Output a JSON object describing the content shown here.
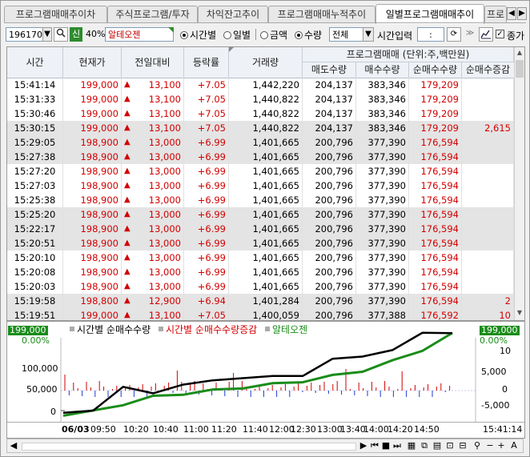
{
  "tabs": [
    {
      "label": "프로그램매매추이차",
      "active": false
    },
    {
      "label": "주식프로그램/투자",
      "active": false
    },
    {
      "label": "차익잔고추이",
      "active": false
    },
    {
      "label": "프로그램매매누적추이",
      "active": false
    },
    {
      "label": "일별프로그램매매추이",
      "active": true
    },
    {
      "label": "프로",
      "active": false
    }
  ],
  "toolbar": {
    "stock_code": "196170",
    "credit_badge": "신",
    "margin_rate": "40%",
    "stock_name": "알테오젠",
    "period_options": [
      "시간별",
      "일별"
    ],
    "period_selected": "시간별",
    "unit_options": [
      "금액",
      "수량"
    ],
    "unit_selected": "수량",
    "market_select": "전체",
    "time_input_label": "시간입력",
    "time_input_value": ":",
    "close_price_label": "종가",
    "close_price_checked": true
  },
  "table": {
    "headers": {
      "time": "시간",
      "price": "현재가",
      "change": "전일대비",
      "rate": "등락률",
      "volume": "거래량",
      "program_group": "프로그램매매 (단위:주,백만원)",
      "sell_qty": "매도수량",
      "buy_qty": "매수수량",
      "net_qty": "순매수수량",
      "net_change": "순매수증감"
    },
    "rows": [
      {
        "time": "15:41:14",
        "price": "199,000",
        "change": "13,100",
        "rate": "+7.05",
        "volume": "1,442,220",
        "sell": "204,137",
        "buy": "383,346",
        "net": "179,209",
        "delta": "",
        "alt": false
      },
      {
        "time": "15:31:33",
        "price": "199,000",
        "change": "13,100",
        "rate": "+7.05",
        "volume": "1,440,822",
        "sell": "204,137",
        "buy": "383,346",
        "net": "179,209",
        "delta": "",
        "alt": false
      },
      {
        "time": "15:30:46",
        "price": "199,000",
        "change": "13,100",
        "rate": "+7.05",
        "volume": "1,440,822",
        "sell": "204,137",
        "buy": "383,346",
        "net": "179,209",
        "delta": "",
        "alt": false
      },
      {
        "time": "15:30:15",
        "price": "199,000",
        "change": "13,100",
        "rate": "+7.05",
        "volume": "1,440,822",
        "sell": "204,137",
        "buy": "383,346",
        "net": "179,209",
        "delta": "2,615",
        "alt": true
      },
      {
        "time": "15:29:05",
        "price": "198,900",
        "change": "13,000",
        "rate": "+6.99",
        "volume": "1,401,665",
        "sell": "200,796",
        "buy": "377,390",
        "net": "176,594",
        "delta": "",
        "alt": true
      },
      {
        "time": "15:27:38",
        "price": "198,900",
        "change": "13,000",
        "rate": "+6.99",
        "volume": "1,401,665",
        "sell": "200,796",
        "buy": "377,390",
        "net": "176,594",
        "delta": "",
        "alt": true
      },
      {
        "time": "15:27:20",
        "price": "198,900",
        "change": "13,000",
        "rate": "+6.99",
        "volume": "1,401,665",
        "sell": "200,796",
        "buy": "377,390",
        "net": "176,594",
        "delta": "",
        "alt": false
      },
      {
        "time": "15:27:03",
        "price": "198,900",
        "change": "13,000",
        "rate": "+6.99",
        "volume": "1,401,665",
        "sell": "200,796",
        "buy": "377,390",
        "net": "176,594",
        "delta": "",
        "alt": false
      },
      {
        "time": "15:25:38",
        "price": "198,900",
        "change": "13,000",
        "rate": "+6.99",
        "volume": "1,401,665",
        "sell": "200,796",
        "buy": "377,390",
        "net": "176,594",
        "delta": "",
        "alt": false
      },
      {
        "time": "15:25:20",
        "price": "198,900",
        "change": "13,000",
        "rate": "+6.99",
        "volume": "1,401,665",
        "sell": "200,796",
        "buy": "377,390",
        "net": "176,594",
        "delta": "",
        "alt": true
      },
      {
        "time": "15:22:17",
        "price": "198,900",
        "change": "13,000",
        "rate": "+6.99",
        "volume": "1,401,665",
        "sell": "200,796",
        "buy": "377,390",
        "net": "176,594",
        "delta": "",
        "alt": true
      },
      {
        "time": "15:20:51",
        "price": "198,900",
        "change": "13,000",
        "rate": "+6.99",
        "volume": "1,401,665",
        "sell": "200,796",
        "buy": "377,390",
        "net": "176,594",
        "delta": "",
        "alt": true
      },
      {
        "time": "15:20:10",
        "price": "198,900",
        "change": "13,000",
        "rate": "+6.99",
        "volume": "1,401,665",
        "sell": "200,796",
        "buy": "377,390",
        "net": "176,594",
        "delta": "",
        "alt": false
      },
      {
        "time": "15:20:08",
        "price": "198,900",
        "change": "13,000",
        "rate": "+6.99",
        "volume": "1,401,665",
        "sell": "200,796",
        "buy": "377,390",
        "net": "176,594",
        "delta": "",
        "alt": false
      },
      {
        "time": "15:20:03",
        "price": "198,900",
        "change": "13,000",
        "rate": "+6.99",
        "volume": "1,401,665",
        "sell": "200,796",
        "buy": "377,390",
        "net": "176,594",
        "delta": "",
        "alt": false
      },
      {
        "time": "15:19:58",
        "price": "198,800",
        "change": "12,900",
        "rate": "+6.94",
        "volume": "1,401,284",
        "sell": "200,796",
        "buy": "377,390",
        "net": "176,594",
        "delta": "2",
        "alt": true
      },
      {
        "time": "15:19:51",
        "price": "199,000",
        "change": "13,100",
        "rate": "+7.05",
        "volume": "1,400,059",
        "sell": "200,796",
        "buy": "377,388",
        "net": "176,592",
        "delta": "10",
        "alt": true
      }
    ]
  },
  "chart": {
    "legend": [
      {
        "label": "시간별 순매수수량",
        "color": "#000000"
      },
      {
        "label": "시간별 순매수수량증감",
        "color": "#d20000"
      },
      {
        "label": "알테오젠",
        "color": "#1a8c1a"
      }
    ],
    "left_badge_price": "199,000",
    "left_badge_pct": "0.00%",
    "right_badge_price": "199,000",
    "right_badge_pct": "0.00%",
    "y_left_ticks": [
      "100,000",
      "50,000",
      "0"
    ],
    "y_right_ticks": [
      "10",
      "5,000",
      "0",
      "-5,000"
    ],
    "date_label": "06/03",
    "x_ticks": [
      "09:50",
      "10:20",
      "10:40",
      "11:00",
      "11:20",
      "11:40",
      "12:00",
      "12:30",
      "13:00",
      "13:40",
      "14:00",
      "14:20",
      "14:50"
    ],
    "cursor_time": "15:41:14",
    "colors": {
      "net_qty": "#000000",
      "delta": "#d20000",
      "price": "#1a8c1a"
    }
  },
  "chart_data": {
    "type": "line",
    "title": "",
    "x_label": "06/03",
    "categories": [
      "09:50",
      "10:20",
      "10:40",
      "11:00",
      "11:20",
      "11:40",
      "12:00",
      "12:30",
      "13:00",
      "13:40",
      "14:00",
      "14:20",
      "14:50",
      "15:41"
    ],
    "series": [
      {
        "name": "시간별 순매수수량",
        "values": [
          -5000,
          0,
          55000,
          40000,
          60000,
          70000,
          75000,
          80000,
          80000,
          120000,
          125000,
          140000,
          180000,
          179209
        ]
      },
      {
        "name": "알테오젠",
        "values": [
          5000,
          10000,
          30000,
          45000,
          55000,
          60000,
          70000,
          75000,
          85000,
          95000,
          110000,
          130000,
          160000,
          199000
        ]
      }
    ],
    "y_left_ticks": [
      100000,
      50000,
      0
    ],
    "y_right_ticks": [
      10,
      5000,
      0,
      -5000
    ],
    "grid": false,
    "legend_position": "top-left"
  },
  "bottom_controls": [
    "◀",
    "▶",
    "⏮",
    "■",
    "⏭",
    "+",
    "-",
    "A"
  ]
}
